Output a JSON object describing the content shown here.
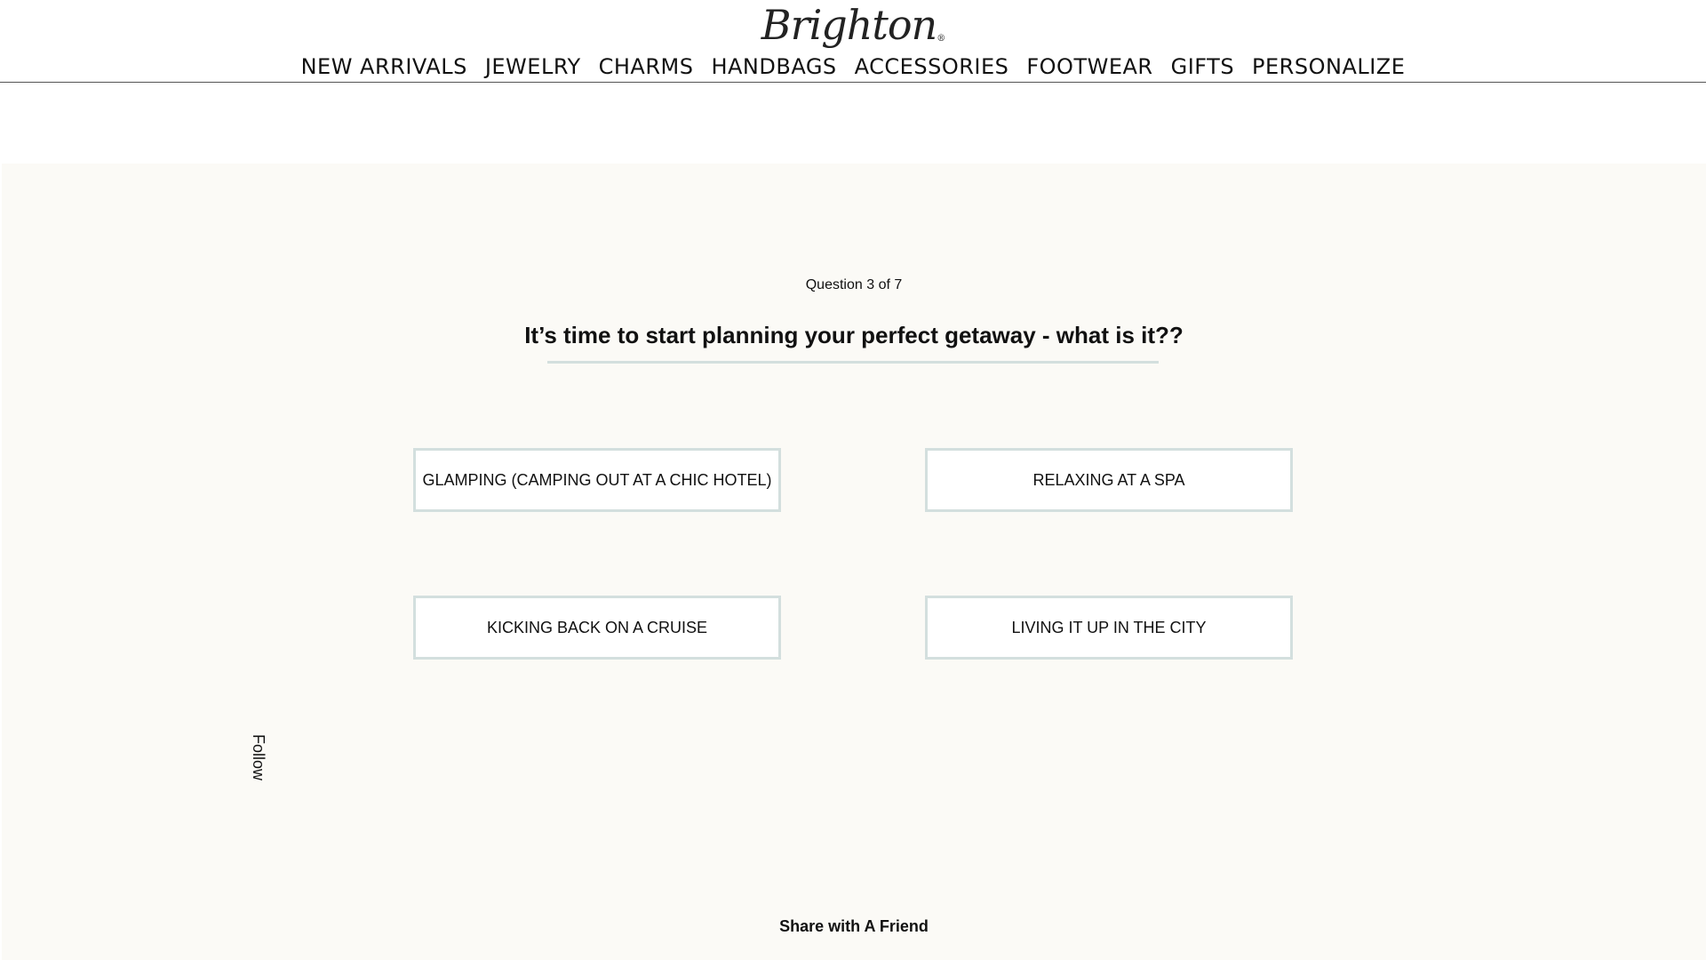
{
  "brand": {
    "logo_text": "Brighton",
    "logo_mark": "®"
  },
  "nav": {
    "items": [
      {
        "label": "NEW ARRIVALS"
      },
      {
        "label": "JEWELRY"
      },
      {
        "label": "CHARMS"
      },
      {
        "label": "HANDBAGS"
      },
      {
        "label": "ACCESSORIES"
      },
      {
        "label": "FOOTWEAR"
      },
      {
        "label": "GIFTS"
      },
      {
        "label": "PERSONALIZE"
      }
    ]
  },
  "quiz": {
    "progress": "Question 3 of 7",
    "question": "It’s time to start planning your perfect getaway - what is it??",
    "answers": [
      {
        "label": "GLAMPING (CAMPING OUT AT A CHIC HOTEL)"
      },
      {
        "label": "RELAXING AT A SPA"
      },
      {
        "label": "KICKING BACK ON A CRUISE"
      },
      {
        "label": "LIVING IT UP IN THE CITY"
      }
    ]
  },
  "sidebar": {
    "follow_label": "Follow"
  },
  "footer": {
    "share_label": "Share with A Friend"
  },
  "colors": {
    "quiz_background": "#fbfaf6",
    "answer_border": "#d3dfde",
    "underline": "#d3dfde"
  }
}
